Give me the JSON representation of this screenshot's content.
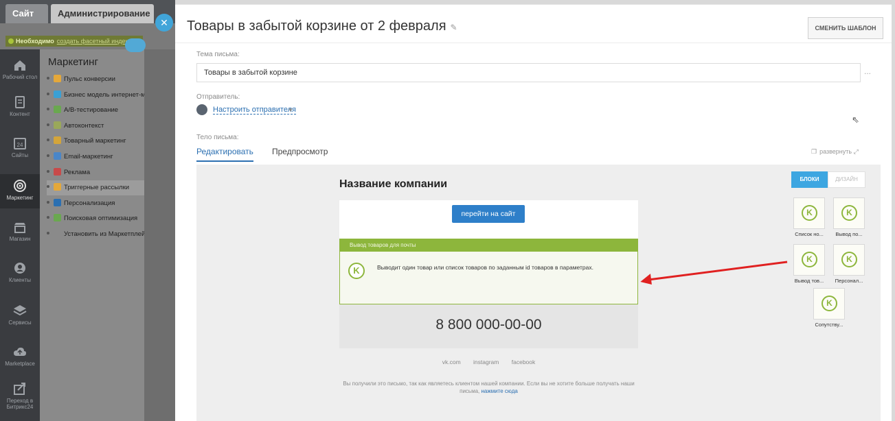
{
  "admin": {
    "tabs": {
      "site": "Сайт",
      "admin": "Администрирование"
    },
    "notice": {
      "strong": "Необходимо",
      "link": "создать фасетный индекс"
    },
    "nav": [
      {
        "label": "Рабочий стол",
        "icon": "home-icon"
      },
      {
        "label": "Контент",
        "icon": "document-icon"
      },
      {
        "label": "Сайты",
        "icon": "calendar-icon"
      },
      {
        "label": "Маркетинг",
        "icon": "target-icon"
      },
      {
        "label": "Магазин",
        "icon": "shop-icon"
      },
      {
        "label": "Клиенты",
        "icon": "clients-icon"
      },
      {
        "label": "Сервисы",
        "icon": "layers-icon"
      },
      {
        "label": "Marketplace",
        "icon": "cloud-upload-icon"
      },
      {
        "label": "Переход в Битрикс24",
        "icon": "bitrix24-icon"
      }
    ],
    "menu": {
      "title": "Маркетинг",
      "items": [
        {
          "label": "Пульс конверсии",
          "color": "#e5a83a"
        },
        {
          "label": "Бизнес модель интернет-магазина",
          "color": "#3aa0d4"
        },
        {
          "label": "A/B-тестирование",
          "color": "#6aa84f"
        },
        {
          "label": "Автоконтекст",
          "color": "#9aa85a"
        },
        {
          "label": "Товарный маркетинг",
          "color": "#d4a53a"
        },
        {
          "label": "Email-маркетинг",
          "color": "#4a86c8"
        },
        {
          "label": "Реклама",
          "color": "#c84a4a"
        },
        {
          "label": "Триггерные рассылки",
          "color": "#e5a83a"
        },
        {
          "label": "Персонализация",
          "color": "#2b6fb1"
        },
        {
          "label": "Поисковая оптимизация",
          "color": "#6aa84f"
        },
        {
          "label": "Установить из Маркетплейс",
          "color": "#8a8a8a"
        }
      ]
    }
  },
  "editor": {
    "title": "Товары в забытой корзине от 2 февраля",
    "change_template": "СМЕНИТЬ ШАБЛОН",
    "subject_label": "Тема письма:",
    "subject_value": "Товары в забытой корзине",
    "more": "...",
    "sender_label": "Отправитель:",
    "sender_link": "Настроить отправителя",
    "body_label": "Тело письма:",
    "tabs": {
      "edit": "Редактировать",
      "preview": "Предпросмотр"
    },
    "expand": "развернуть"
  },
  "letter": {
    "company": "Название компании",
    "site_button": "перейти на сайт",
    "block_header": "Вывод товаров для почты",
    "block_desc": "Выводит один товар или список товаров по заданным id товаров в параметрах.",
    "phone": "8 800 000-00-00",
    "socials": [
      "vk.com",
      "instagram",
      "facebook"
    ],
    "footer_text": "Вы получили это письмо, так как являетесь клиентом нашей компании. Если вы не хотите больше получать наши письма,",
    "footer_link": "нажмите сюда"
  },
  "palette": {
    "blocks": "БЛОКИ",
    "design": "ДИЗАЙН",
    "tiles": [
      {
        "label": "Список но..."
      },
      {
        "label": "Вывод по..."
      },
      {
        "label": "Вывод тов..."
      },
      {
        "label": "Персонал..."
      },
      {
        "label": "Сопутству..."
      }
    ],
    "tile_glyph": "K"
  },
  "colors": {
    "accent": "#3da6e1",
    "block_green": "#8db63c",
    "link": "#2b6fb1",
    "arrow": "#e02020"
  }
}
